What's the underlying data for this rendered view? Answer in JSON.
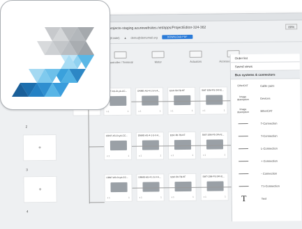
{
  "browser": {
    "url": "...myprojects-staging.azurewebsites.net/apps/ProjectEditor-324-362",
    "zoom": "80%",
    "icons": "⋯ ☺ ☆ |\\ ⊡"
  },
  "infobar": {
    "user": "Admin (Kindel)",
    "account": "demo@demomail.org",
    "button": "DOWNLOAD PDF"
  },
  "categories": [
    {
      "label": "Controller / Terminal"
    },
    {
      "label": "Motor"
    },
    {
      "label": "Actuators"
    },
    {
      "label": "Accessories / Software"
    }
  ],
  "panel": {
    "tabs": [
      "Order list",
      "Saved views",
      "Bus systems & connectors"
    ],
    "items": [
      {
        "icon": "EtherCAT",
        "label": "Cable pairs"
      },
      {
        "icon": "Image description",
        "label": "Devices"
      },
      {
        "icon": "Image description",
        "label": "EtherCAT"
      },
      {
        "icon": "line",
        "label": "T-Connection"
      },
      {
        "icon": "line",
        "label": "T-Connection"
      },
      {
        "icon": "line",
        "label": "L-Connection"
      },
      {
        "icon": "line",
        "label": "+ Connection"
      },
      {
        "icon": "line",
        "label": "- Connection"
      },
      {
        "icon": "line",
        "label": "T1-Connection"
      },
      {
        "icon": "T",
        "label": "Text"
      }
    ]
  },
  "rows": [
    {
      "number": "2",
      "plus": "+"
    },
    {
      "number": "3",
      "plus": "+"
    },
    {
      "number": "4",
      "plus": "+"
    }
  ],
  "components": [
    {
      "label": "CRNT AS-Ct-yA-CC...",
      "qty": "x 1",
      "unit": "1"
    },
    {
      "label": "DNME-AS-4-1-5-V-A...",
      "qty": "x 1",
      "unit": "1"
    },
    {
      "label": "EGC-50-TB-KF",
      "qty": "x 1",
      "unit": "1"
    },
    {
      "label": "SMT-10M-PS-24V-E...",
      "qty": "x 1",
      "unit": "1"
    }
  ]
}
